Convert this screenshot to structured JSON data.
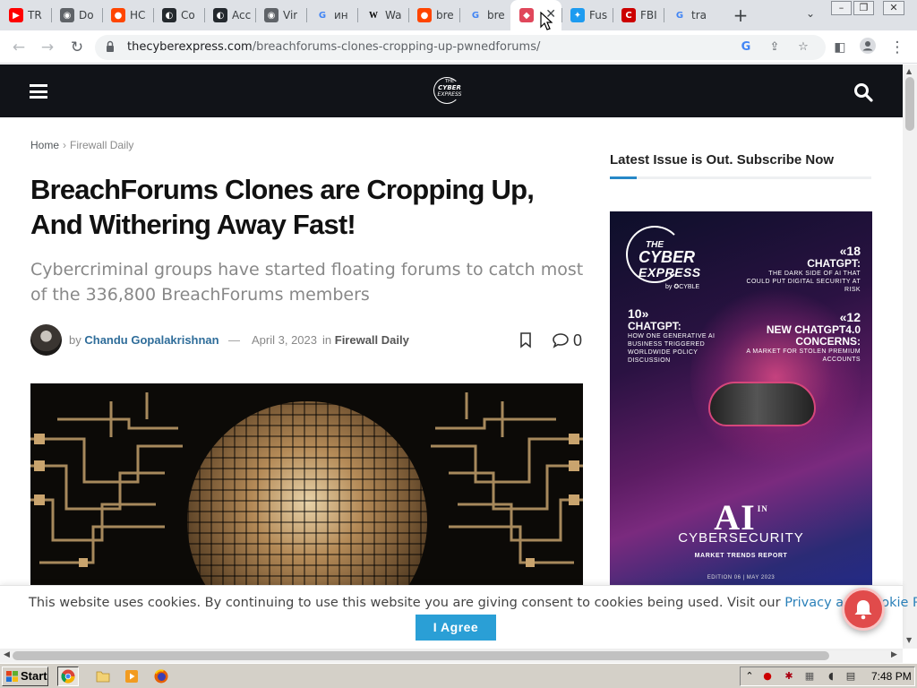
{
  "browser": {
    "tabs": [
      {
        "title": "TR",
        "icon": "youtube-icon",
        "color": "#ff0000",
        "glyph": "▶"
      },
      {
        "title": "Do",
        "icon": "globe-icon",
        "color": "#5f6368",
        "glyph": "◉"
      },
      {
        "title": "HC",
        "icon": "reddit-icon",
        "color": "#ff4500",
        "glyph": "●"
      },
      {
        "title": "Co",
        "icon": "github-icon",
        "color": "#24292e",
        "glyph": "◐"
      },
      {
        "title": "Acc",
        "icon": "github-icon",
        "color": "#24292e",
        "glyph": "◐"
      },
      {
        "title": "Vir",
        "icon": "globe-icon",
        "color": "#5f6368",
        "glyph": "◉"
      },
      {
        "title": "ин",
        "icon": "google-icon",
        "color": "#4285f4",
        "glyph": "G"
      },
      {
        "title": "Wa",
        "icon": "wikipedia-icon",
        "color": "#000000",
        "glyph": "W"
      },
      {
        "title": "bre",
        "icon": "reddit-icon",
        "color": "#ff4500",
        "glyph": "●"
      },
      {
        "title": "bre",
        "icon": "google-icon",
        "color": "#4285f4",
        "glyph": "G"
      },
      {
        "title": "",
        "icon": "cyberexpress-icon",
        "color": "#e0475b",
        "glyph": "◆",
        "active": true
      },
      {
        "title": "Fus",
        "icon": "twitter-icon",
        "color": "#1d9bf0",
        "glyph": "✦"
      },
      {
        "title": "FBI",
        "icon": "cnn-icon",
        "color": "#cc0000",
        "glyph": "C"
      },
      {
        "title": "tra",
        "icon": "google-icon",
        "color": "#4285f4",
        "glyph": "G"
      }
    ],
    "url_domain": "thecyberexpress.com",
    "url_path": "/breachforums-clones-cropping-up-pwnedforums/"
  },
  "site": {
    "logo": {
      "line1": "THE",
      "line2": "CYBER",
      "line3": "EXPRESS"
    }
  },
  "article": {
    "breadcrumb": {
      "home": "Home",
      "separator": "›",
      "category": "Firewall Daily"
    },
    "title": "BreachForums Clones are Cropping Up, And Withering Away Fast!",
    "subtitle": "Cybercriminal groups have started floating forums to catch most of the 336,800 BreachForums members",
    "by_label": "by",
    "author": "Chandu Gopalakrishnan",
    "dash": "—",
    "date": "April 3, 2023",
    "in_label": "in",
    "category": "Firewall Daily",
    "comment_count": "0"
  },
  "sidebar": {
    "heading": "Latest Issue is Out. Subscribe Now",
    "accent_color": "#2788c7",
    "promo": {
      "brand_the": "THE",
      "brand_cyber": "CYBER",
      "brand_express": "EXPRESS",
      "brand_by": "by ✪CYBLE",
      "item1_num": "«18",
      "item1_title": "CHATGPT:",
      "item1_sub": "THE DARK SIDE OF AI THAT COULD PUT DIGITAL SECURITY AT RISK",
      "item2_num": "10»",
      "item2_title": "CHATGPT:",
      "item2_sub": "HOW ONE GENERATIVE AI BUSINESS TRIGGERED WORLDWIDE POLICY DISCUSSION",
      "item3_num": "«12",
      "item3_title": "NEW CHATGPT4.0 CONCERNS:",
      "item3_sub": "A MARKET FOR STOLEN PREMIUM ACCOUNTS",
      "ai": "AI",
      "ai_in": "IN",
      "cybersecurity": "CYBERSECURITY",
      "report": "MARKET TRENDS REPORT",
      "edition": "EDITION 06 | MAY 2023"
    }
  },
  "cookie": {
    "message": "This website uses cookies. By continuing to use this website you are giving consent to cookies being used. Visit our ",
    "link": "Privacy and Cookie Policy.",
    "button": "I Agree"
  },
  "taskbar": {
    "start": "Start",
    "clock": "7:48 PM"
  }
}
